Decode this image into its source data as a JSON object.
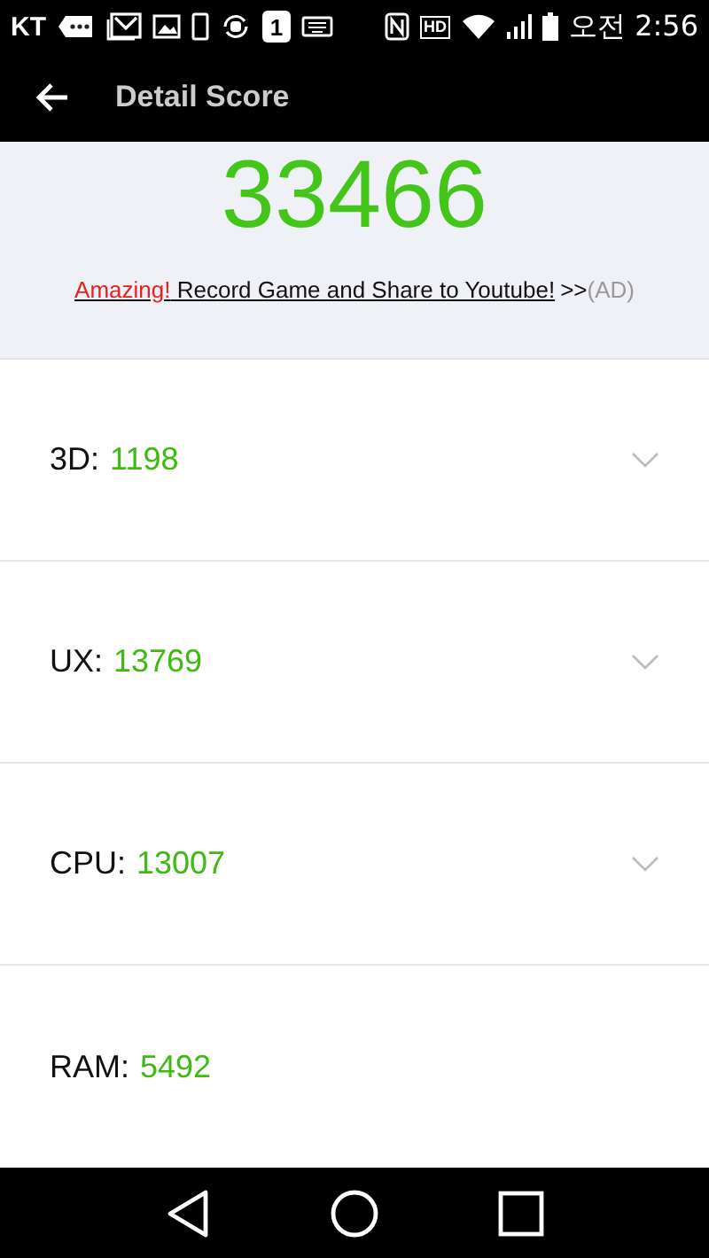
{
  "status_bar": {
    "carrier": "KT",
    "calendar_day": "1",
    "hd_label": "HD",
    "time": "오전 2:56"
  },
  "app_bar": {
    "title": "Detail Score"
  },
  "total_score": "33466",
  "ad": {
    "highlight": "Amazing!",
    "link": "Record Game and Share to Youtube!",
    "arrows": ">>",
    "tag": "(AD)"
  },
  "scores": [
    {
      "label": "3D:",
      "value": "1198",
      "expandable": true
    },
    {
      "label": "UX:",
      "value": "13769",
      "expandable": true
    },
    {
      "label": "CPU:",
      "value": "13007",
      "expandable": true
    },
    {
      "label": "RAM:",
      "value": "5492",
      "expandable": false
    }
  ]
}
